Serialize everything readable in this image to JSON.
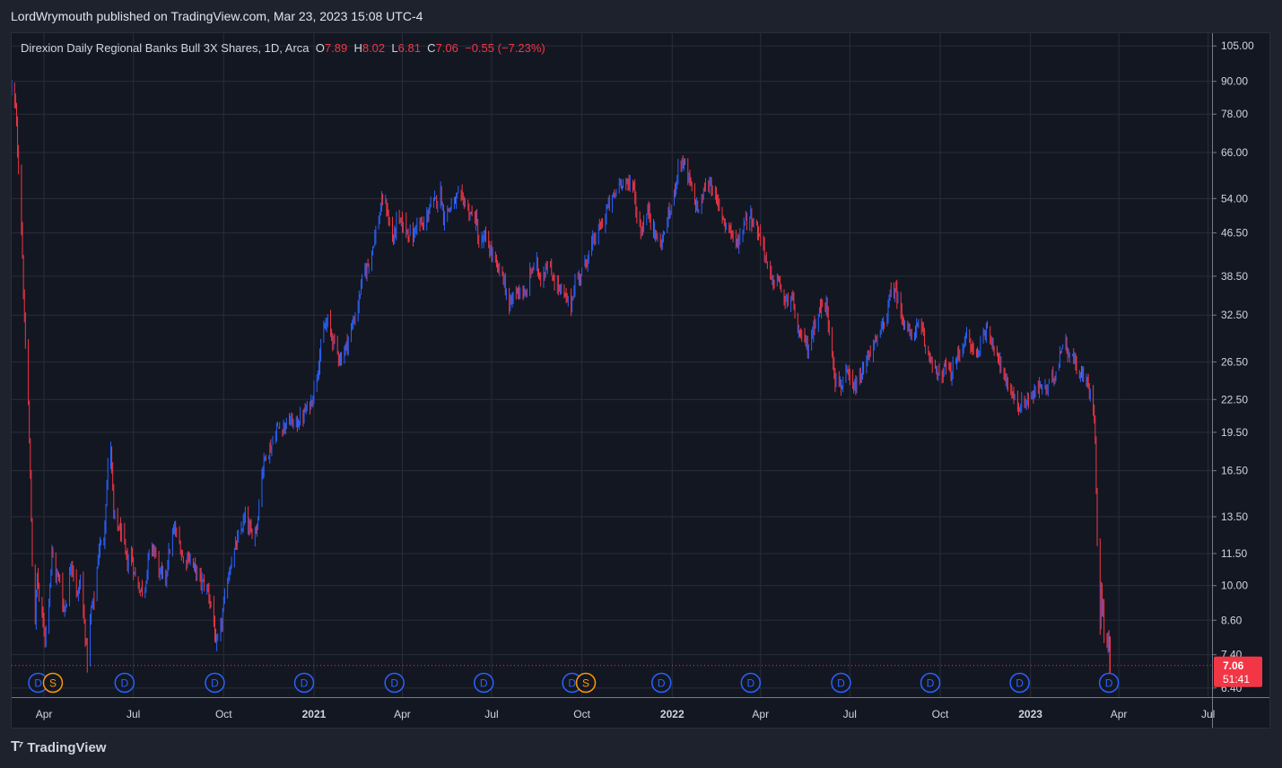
{
  "header": {
    "published_line": "LordWrymouth published on TradingView.com, Mar 23, 2023 15:08 UTC-4"
  },
  "legend": {
    "symbol_desc": "Direxion Daily Regional Banks Bull 3X Shares, 1D, Arca",
    "open_label": "O",
    "open_value": "7.89",
    "high_label": "H",
    "high_value": "8.02",
    "low_label": "L",
    "low_value": "6.81",
    "close_label": "C",
    "close_value": "7.06",
    "change": "−0.55 (−7.23%)"
  },
  "price_tag": {
    "price": "7.06",
    "countdown": "51:41"
  },
  "footer": {
    "logo_text": "TradingView"
  },
  "colors": {
    "background": "#131722",
    "frame": "#1e222d",
    "grid": "#2a2e39",
    "up": "#2962ff",
    "down": "#f23645",
    "marker_dividend": "#2962ff",
    "marker_split": "#ff9800"
  },
  "chart_data": {
    "type": "ohlc",
    "scale": "log",
    "grid": true,
    "title": "Direxion Daily Regional Banks Bull 3X Shares, 1D, Arca",
    "y_ticks": [
      "105.00",
      "90.00",
      "78.00",
      "66.00",
      "54.00",
      "46.50",
      "38.50",
      "32.50",
      "26.50",
      "22.50",
      "19.50",
      "16.50",
      "13.50",
      "11.50",
      "10.00",
      "8.60",
      "7.40",
      "6.40"
    ],
    "ylim": [
      6.2,
      108
    ],
    "x_ticks": [
      {
        "date": "2020-04-01",
        "label": "Apr",
        "bold": false
      },
      {
        "date": "2020-07-01",
        "label": "Jul",
        "bold": false
      },
      {
        "date": "2020-10-01",
        "label": "Oct",
        "bold": false
      },
      {
        "date": "2021-01-01",
        "label": "2021",
        "bold": true
      },
      {
        "date": "2021-04-01",
        "label": "Apr",
        "bold": false
      },
      {
        "date": "2021-07-01",
        "label": "Jul",
        "bold": false
      },
      {
        "date": "2021-10-01",
        "label": "Oct",
        "bold": false
      },
      {
        "date": "2022-01-01",
        "label": "2022",
        "bold": true
      },
      {
        "date": "2022-04-01",
        "label": "Apr",
        "bold": false
      },
      {
        "date": "2022-07-01",
        "label": "Jul",
        "bold": false
      },
      {
        "date": "2022-10-01",
        "label": "Oct",
        "bold": false
      },
      {
        "date": "2023-01-01",
        "label": "2023",
        "bold": true
      },
      {
        "date": "2023-04-01",
        "label": "Apr",
        "bold": false
      },
      {
        "date": "2023-07-01",
        "label": "Jul",
        "bold": false
      }
    ],
    "xlim": [
      "2020-02-28",
      "2023-07-05"
    ],
    "last_price": 7.06,
    "event_markers": [
      {
        "date": "2020-03-26",
        "type": "D"
      },
      {
        "date": "2020-04-10",
        "type": "S"
      },
      {
        "date": "2020-06-22",
        "type": "D"
      },
      {
        "date": "2020-09-22",
        "type": "D"
      },
      {
        "date": "2020-12-22",
        "type": "D"
      },
      {
        "date": "2021-03-24",
        "type": "D"
      },
      {
        "date": "2021-06-23",
        "type": "D"
      },
      {
        "date": "2021-09-21",
        "type": "D"
      },
      {
        "date": "2021-10-05",
        "type": "S"
      },
      {
        "date": "2021-12-21",
        "type": "D"
      },
      {
        "date": "2022-03-22",
        "type": "D"
      },
      {
        "date": "2022-06-22",
        "type": "D"
      },
      {
        "date": "2022-09-21",
        "type": "D"
      },
      {
        "date": "2022-12-21",
        "type": "D"
      },
      {
        "date": "2023-03-22",
        "type": "D"
      }
    ],
    "close_path": [
      [
        "2020-02-28",
        88
      ],
      [
        "2020-03-03",
        80
      ],
      [
        "2020-03-06",
        62
      ],
      [
        "2020-03-09",
        48
      ],
      [
        "2020-03-10",
        42
      ],
      [
        "2020-03-12",
        31
      ],
      [
        "2020-03-16",
        22
      ],
      [
        "2020-03-18",
        16
      ],
      [
        "2020-03-20",
        11
      ],
      [
        "2020-03-23",
        8.6
      ],
      [
        "2020-03-25",
        10.5
      ],
      [
        "2020-03-27",
        9.5
      ],
      [
        "2020-04-02",
        8.0
      ],
      [
        "2020-04-06",
        9.5
      ],
      [
        "2020-04-09",
        11.5
      ],
      [
        "2020-04-13",
        10.5
      ],
      [
        "2020-04-17",
        10.3
      ],
      [
        "2020-04-21",
        9.0
      ],
      [
        "2020-04-24",
        9.4
      ],
      [
        "2020-04-29",
        11.2
      ],
      [
        "2020-05-05",
        9.5
      ],
      [
        "2020-05-08",
        10.3
      ],
      [
        "2020-05-13",
        8.1
      ],
      [
        "2020-05-15",
        7.2
      ],
      [
        "2020-05-19",
        9.0
      ],
      [
        "2020-05-22",
        9.4
      ],
      [
        "2020-05-27",
        11.8
      ],
      [
        "2020-06-01",
        12.3
      ],
      [
        "2020-06-05",
        16.8
      ],
      [
        "2020-06-08",
        18.5
      ],
      [
        "2020-06-11",
        13.5
      ],
      [
        "2020-06-15",
        13.0
      ],
      [
        "2020-06-19",
        12.5
      ],
      [
        "2020-06-25",
        11.0
      ],
      [
        "2020-06-29",
        11.5
      ],
      [
        "2020-07-02",
        10.5
      ],
      [
        "2020-07-08",
        9.8
      ],
      [
        "2020-07-13",
        10.0
      ],
      [
        "2020-07-17",
        11.5
      ],
      [
        "2020-07-22",
        11.8
      ],
      [
        "2020-07-28",
        10.5
      ],
      [
        "2020-08-03",
        10.4
      ],
      [
        "2020-08-07",
        11.8
      ],
      [
        "2020-08-12",
        12.8
      ],
      [
        "2020-08-17",
        12.0
      ],
      [
        "2020-08-21",
        11.1
      ],
      [
        "2020-08-26",
        11.4
      ],
      [
        "2020-09-01",
        10.8
      ],
      [
        "2020-09-08",
        10.2
      ],
      [
        "2020-09-15",
        9.8
      ],
      [
        "2020-09-21",
        8.6
      ],
      [
        "2020-09-23",
        7.6
      ],
      [
        "2020-09-28",
        8.3
      ],
      [
        "2020-10-02",
        9.5
      ],
      [
        "2020-10-08",
        11.0
      ],
      [
        "2020-10-13",
        11.8
      ],
      [
        "2020-10-19",
        12.8
      ],
      [
        "2020-10-23",
        13.5
      ],
      [
        "2020-10-29",
        12.5
      ],
      [
        "2020-11-04",
        13.0
      ],
      [
        "2020-11-09",
        16.5
      ],
      [
        "2020-11-13",
        17.8
      ],
      [
        "2020-11-18",
        18.2
      ],
      [
        "2020-11-24",
        19.8
      ],
      [
        "2020-11-30",
        20.0
      ],
      [
        "2020-12-07",
        20.5
      ],
      [
        "2020-12-14",
        20.2
      ],
      [
        "2020-12-21",
        21.0
      ],
      [
        "2020-12-30",
        22.5
      ],
      [
        "2021-01-06",
        26.5
      ],
      [
        "2021-01-11",
        30.5
      ],
      [
        "2021-01-15",
        31.5
      ],
      [
        "2021-01-21",
        29.0
      ],
      [
        "2021-01-28",
        26.8
      ],
      [
        "2021-02-03",
        28.5
      ],
      [
        "2021-02-09",
        31.0
      ],
      [
        "2021-02-15",
        34.0
      ],
      [
        "2021-02-19",
        38.0
      ],
      [
        "2021-02-25",
        40.5
      ],
      [
        "2021-03-02",
        44.0
      ],
      [
        "2021-03-08",
        49.5
      ],
      [
        "2021-03-12",
        54.0
      ],
      [
        "2021-03-16",
        52.0
      ],
      [
        "2021-03-19",
        48.0
      ],
      [
        "2021-03-23",
        45.0
      ],
      [
        "2021-03-26",
        49.0
      ],
      [
        "2021-03-31",
        48.5
      ],
      [
        "2021-04-06",
        47.0
      ],
      [
        "2021-04-12",
        45.5
      ],
      [
        "2021-04-16",
        49.0
      ],
      [
        "2021-04-22",
        47.5
      ],
      [
        "2021-04-29",
        52.0
      ],
      [
        "2021-05-05",
        53.5
      ],
      [
        "2021-05-10",
        55.5
      ],
      [
        "2021-05-13",
        50.0
      ],
      [
        "2021-05-18",
        51.5
      ],
      [
        "2021-05-24",
        53.0
      ],
      [
        "2021-05-28",
        54.5
      ],
      [
        "2021-06-03",
        53.5
      ],
      [
        "2021-06-09",
        50.5
      ],
      [
        "2021-06-15",
        49.5
      ],
      [
        "2021-06-18",
        44.0
      ],
      [
        "2021-06-24",
        45.5
      ],
      [
        "2021-06-30",
        43.0
      ],
      [
        "2021-07-06",
        40.0
      ],
      [
        "2021-07-12",
        39.0
      ],
      [
        "2021-07-19",
        33.5
      ],
      [
        "2021-07-23",
        35.5
      ],
      [
        "2021-07-29",
        36.5
      ],
      [
        "2021-08-04",
        35.0
      ],
      [
        "2021-08-10",
        39.5
      ],
      [
        "2021-08-16",
        40.5
      ],
      [
        "2021-08-20",
        38.0
      ],
      [
        "2021-08-26",
        40.5
      ],
      [
        "2021-09-01",
        38.5
      ],
      [
        "2021-09-08",
        36.5
      ],
      [
        "2021-09-14",
        35.0
      ],
      [
        "2021-09-20",
        34.0
      ],
      [
        "2021-09-24",
        37.5
      ],
      [
        "2021-09-30",
        39.0
      ],
      [
        "2021-10-06",
        41.5
      ],
      [
        "2021-10-12",
        44.5
      ],
      [
        "2021-10-18",
        47.0
      ],
      [
        "2021-10-22",
        48.5
      ],
      [
        "2021-10-28",
        52.5
      ],
      [
        "2021-11-03",
        54.5
      ],
      [
        "2021-11-08",
        58.0
      ],
      [
        "2021-11-12",
        58.5
      ],
      [
        "2021-11-17",
        57.0
      ],
      [
        "2021-11-22",
        58.5
      ],
      [
        "2021-11-26",
        50.0
      ],
      [
        "2021-11-30",
        47.0
      ],
      [
        "2021-12-03",
        48.5
      ],
      [
        "2021-12-08",
        51.5
      ],
      [
        "2021-12-14",
        46.5
      ],
      [
        "2021-12-20",
        44.0
      ],
      [
        "2021-12-27",
        49.0
      ],
      [
        "2022-01-03",
        55.0
      ],
      [
        "2022-01-07",
        62.5
      ],
      [
        "2022-01-12",
        63.5
      ],
      [
        "2022-01-18",
        58.5
      ],
      [
        "2022-01-24",
        53.5
      ],
      [
        "2022-01-28",
        51.0
      ],
      [
        "2022-02-03",
        56.5
      ],
      [
        "2022-02-09",
        58.0
      ],
      [
        "2022-02-15",
        53.5
      ],
      [
        "2022-02-23",
        49.0
      ],
      [
        "2022-03-01",
        47.5
      ],
      [
        "2022-03-07",
        44.0
      ],
      [
        "2022-03-11",
        45.5
      ],
      [
        "2022-03-16",
        49.5
      ],
      [
        "2022-03-22",
        50.0
      ],
      [
        "2022-03-29",
        47.0
      ],
      [
        "2022-04-04",
        44.0
      ],
      [
        "2022-04-08",
        40.0
      ],
      [
        "2022-04-13",
        37.5
      ],
      [
        "2022-04-19",
        38.0
      ],
      [
        "2022-04-26",
        34.0
      ],
      [
        "2022-05-02",
        35.5
      ],
      [
        "2022-05-06",
        32.5
      ],
      [
        "2022-05-11",
        29.5
      ],
      [
        "2022-05-16",
        29.0
      ],
      [
        "2022-05-20",
        28.0
      ],
      [
        "2022-05-26",
        31.5
      ],
      [
        "2022-06-01",
        33.5
      ],
      [
        "2022-06-07",
        34.0
      ],
      [
        "2022-06-10",
        30.5
      ],
      [
        "2022-06-14",
        27.0
      ],
      [
        "2022-06-16",
        24.5
      ],
      [
        "2022-06-22",
        24.0
      ],
      [
        "2022-06-28",
        25.0
      ],
      [
        "2022-07-05",
        23.5
      ],
      [
        "2022-07-11",
        24.5
      ],
      [
        "2022-07-15",
        25.5
      ],
      [
        "2022-07-20",
        27.5
      ],
      [
        "2022-07-26",
        28.5
      ],
      [
        "2022-08-01",
        30.0
      ],
      [
        "2022-08-08",
        33.0
      ],
      [
        "2022-08-12",
        36.0
      ],
      [
        "2022-08-16",
        36.5
      ],
      [
        "2022-08-22",
        33.0
      ],
      [
        "2022-08-26",
        31.5
      ],
      [
        "2022-09-01",
        29.5
      ],
      [
        "2022-09-08",
        31.0
      ],
      [
        "2022-09-13",
        30.0
      ],
      [
        "2022-09-16",
        28.0
      ],
      [
        "2022-09-22",
        27.0
      ],
      [
        "2022-09-27",
        25.5
      ],
      [
        "2022-09-30",
        24.5
      ],
      [
        "2022-10-06",
        26.0
      ],
      [
        "2022-10-12",
        25.0
      ],
      [
        "2022-10-18",
        27.0
      ],
      [
        "2022-10-24",
        28.5
      ],
      [
        "2022-10-28",
        29.5
      ],
      [
        "2022-11-03",
        28.0
      ],
      [
        "2022-11-09",
        27.5
      ],
      [
        "2022-11-14",
        30.5
      ],
      [
        "2022-11-18",
        30.0
      ],
      [
        "2022-11-25",
        28.5
      ],
      [
        "2022-12-01",
        26.5
      ],
      [
        "2022-12-07",
        24.0
      ],
      [
        "2022-12-13",
        23.5
      ],
      [
        "2022-12-19",
        21.5
      ],
      [
        "2022-12-23",
        22.0
      ],
      [
        "2022-12-29",
        22.5
      ],
      [
        "2023-01-05",
        23.0
      ],
      [
        "2023-01-11",
        24.0
      ],
      [
        "2023-01-17",
        23.5
      ],
      [
        "2023-01-23",
        24.5
      ],
      [
        "2023-01-27",
        25.5
      ],
      [
        "2023-02-02",
        28.5
      ],
      [
        "2023-02-06",
        28.5
      ],
      [
        "2023-02-10",
        27.5
      ],
      [
        "2023-02-15",
        26.5
      ],
      [
        "2023-02-21",
        25.0
      ],
      [
        "2023-02-27",
        24.5
      ],
      [
        "2023-03-03",
        23.0
      ],
      [
        "2023-03-06",
        22.0
      ],
      [
        "2023-03-08",
        19.5
      ],
      [
        "2023-03-09",
        15.5
      ],
      [
        "2023-03-10",
        12.0
      ],
      [
        "2023-03-13",
        8.5
      ],
      [
        "2023-03-14",
        10.0
      ],
      [
        "2023-03-15",
        8.8
      ],
      [
        "2023-03-16",
        9.2
      ],
      [
        "2023-03-17",
        8.0
      ],
      [
        "2023-03-20",
        7.8
      ],
      [
        "2023-03-21",
        8.2
      ],
      [
        "2023-03-22",
        7.6
      ],
      [
        "2023-03-23",
        7.06
      ]
    ]
  }
}
